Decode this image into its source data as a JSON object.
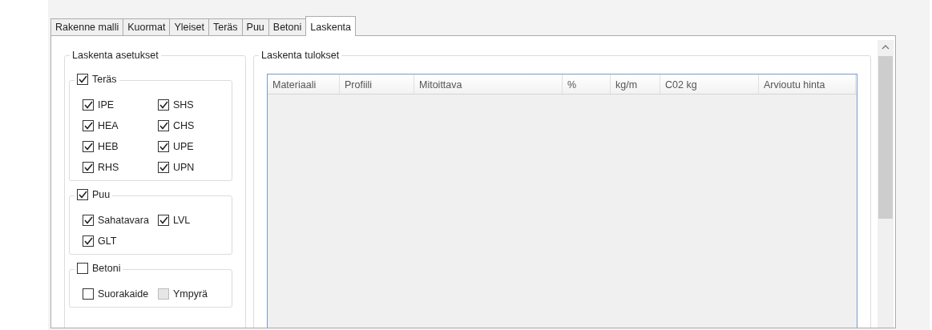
{
  "tabs": [
    {
      "label": "Rakenne malli",
      "selected": false
    },
    {
      "label": "Kuormat",
      "selected": false
    },
    {
      "label": "Yleiset",
      "selected": false
    },
    {
      "label": "Teräs",
      "selected": false
    },
    {
      "label": "Puu",
      "selected": false
    },
    {
      "label": "Betoni",
      "selected": false
    },
    {
      "label": "Laskenta",
      "selected": true
    }
  ],
  "settings": {
    "title": "Laskenta asetukset",
    "groups": [
      {
        "label": "Teräs",
        "checked": true,
        "options": [
          {
            "label": "IPE",
            "checked": true,
            "disabled": false
          },
          {
            "label": "SHS",
            "checked": true,
            "disabled": false
          },
          {
            "label": "HEA",
            "checked": true,
            "disabled": false
          },
          {
            "label": "CHS",
            "checked": true,
            "disabled": false
          },
          {
            "label": "HEB",
            "checked": true,
            "disabled": false
          },
          {
            "label": "UPE",
            "checked": true,
            "disabled": false
          },
          {
            "label": "RHS",
            "checked": true,
            "disabled": false
          },
          {
            "label": "UPN",
            "checked": true,
            "disabled": false
          }
        ]
      },
      {
        "label": "Puu",
        "checked": true,
        "options": [
          {
            "label": "Sahatavara",
            "checked": true,
            "disabled": false
          },
          {
            "label": "LVL",
            "checked": true,
            "disabled": false
          },
          {
            "label": "GLT",
            "checked": true,
            "disabled": false
          }
        ]
      },
      {
        "label": "Betoni",
        "checked": false,
        "options": [
          {
            "label": "Suorakaide",
            "checked": false,
            "disabled": false
          },
          {
            "label": "Ympyrä",
            "checked": false,
            "disabled": true
          }
        ]
      }
    ]
  },
  "results": {
    "title": "Laskenta tulokset",
    "table": {
      "columns": [
        "Materiaali",
        "Profiili",
        "Mitoittava",
        "%",
        "kg/m",
        "C02 kg",
        "Arvioutu hinta"
      ]
    }
  }
}
